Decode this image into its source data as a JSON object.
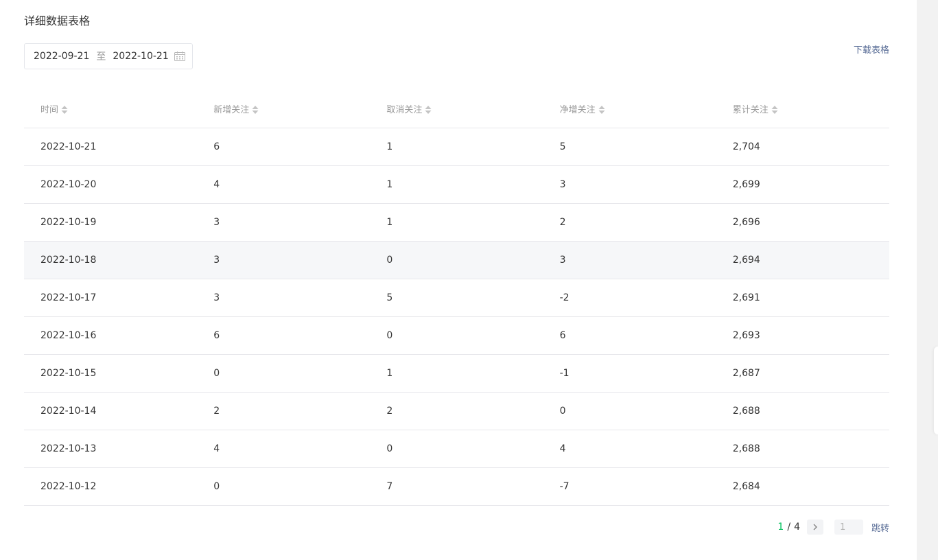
{
  "section": {
    "title": "详细数据表格"
  },
  "date_range": {
    "start": "2022-09-21",
    "separator": "至",
    "end": "2022-10-21"
  },
  "download": {
    "label": "下载表格"
  },
  "table": {
    "columns": [
      "时间",
      "新增关注",
      "取消关注",
      "净增关注",
      "累计关注"
    ],
    "rows": [
      [
        "2022-10-21",
        "6",
        "1",
        "5",
        "2,704"
      ],
      [
        "2022-10-20",
        "4",
        "1",
        "3",
        "2,699"
      ],
      [
        "2022-10-19",
        "3",
        "1",
        "2",
        "2,696"
      ],
      [
        "2022-10-18",
        "3",
        "0",
        "3",
        "2,694"
      ],
      [
        "2022-10-17",
        "3",
        "5",
        "-2",
        "2,691"
      ],
      [
        "2022-10-16",
        "6",
        "0",
        "6",
        "2,693"
      ],
      [
        "2022-10-15",
        "0",
        "1",
        "-1",
        "2,687"
      ],
      [
        "2022-10-14",
        "2",
        "2",
        "0",
        "2,688"
      ],
      [
        "2022-10-13",
        "4",
        "0",
        "4",
        "2,688"
      ],
      [
        "2022-10-12",
        "0",
        "7",
        "-7",
        "2,684"
      ]
    ],
    "highlighted_row": 3
  },
  "pagination": {
    "current": "1",
    "separator": "/",
    "total": "4",
    "input_placeholder": "1",
    "jump_label": "跳转"
  },
  "colors": {
    "accent_green": "#07c160",
    "link_blue": "#576b95"
  }
}
